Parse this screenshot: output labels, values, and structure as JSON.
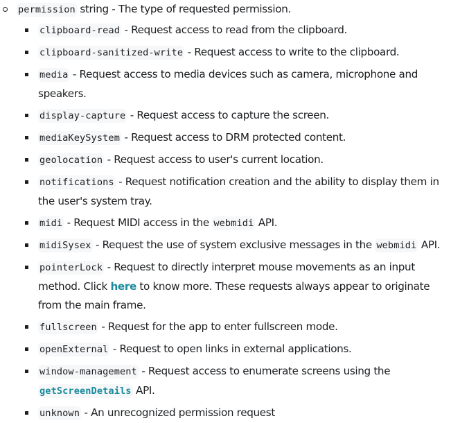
{
  "param": {
    "name": "permission",
    "type": "string",
    "description": " - The type of requested permission."
  },
  "permissions": [
    {
      "code": "clipboard-read",
      "pre": " - Request access to read from the clipboard."
    },
    {
      "code": "clipboard-sanitized-write",
      "pre": " - Request access to write to the clipboard."
    },
    {
      "code": "media",
      "pre": " - Request access to media devices such as camera, microphone and speakers."
    },
    {
      "code": "display-capture",
      "pre": " - Request access to capture the screen."
    },
    {
      "code": "mediaKeySystem",
      "pre": " - Request access to DRM protected content."
    },
    {
      "code": "geolocation",
      "pre": " - Request access to user's current location."
    },
    {
      "code": "notifications",
      "pre": " - Request notification creation and the ability to display them in the user's system tray."
    },
    {
      "code": "midi",
      "pre": " - Request MIDI access in the ",
      "inline_code": "webmidi",
      "post": " API."
    },
    {
      "code": "midiSysex",
      "pre": " - Request the use of system exclusive messages in the ",
      "inline_code": "webmidi",
      "post": " API."
    },
    {
      "code": "pointerLock",
      "pre": " - Request to directly interpret mouse movements as an input method. Click ",
      "link": "here",
      "post": " to know more. These requests always appear to originate from the main frame."
    },
    {
      "code": "fullscreen",
      "pre": " - Request for the app to enter fullscreen mode."
    },
    {
      "code": "openExternal",
      "pre": " - Request to open links in external applications."
    },
    {
      "code": "window-management",
      "pre": " - Request access to enumerate screens using the ",
      "link_code": "getScreenDetails",
      "post": " API."
    },
    {
      "code": "unknown",
      "pre": " - An unrecognized permission request"
    }
  ],
  "colors": {
    "text": "#1c1e21",
    "link": "#1b8b9b",
    "code_bg": "#f6f7f8"
  }
}
